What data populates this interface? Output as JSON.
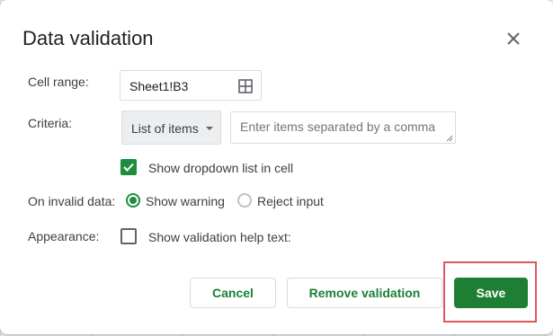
{
  "dialog": {
    "title": "Data validation",
    "close_icon": "close-icon"
  },
  "cell_range": {
    "label": "Cell range:",
    "value": "Sheet1!B3",
    "icon": "select-range-grid-icon"
  },
  "criteria": {
    "label": "Criteria:",
    "selected": "List of items",
    "items_placeholder": "Enter items separated by a comma",
    "items_value": ""
  },
  "dropdown_option": {
    "label": "Show dropdown list in cell",
    "checked": true
  },
  "invalid_data": {
    "label": "On invalid data:",
    "options": [
      {
        "label": "Show warning",
        "selected": true
      },
      {
        "label": "Reject input",
        "selected": false
      }
    ]
  },
  "appearance": {
    "label": "Appearance:",
    "help_text_label": "Show validation help text:",
    "checked": false
  },
  "buttons": {
    "cancel": "Cancel",
    "remove": "Remove validation",
    "save": "Save"
  },
  "colors": {
    "accent_green": "#1e8e3e",
    "primary_button": "#1e7e34",
    "highlight_outline": "#e15759"
  }
}
